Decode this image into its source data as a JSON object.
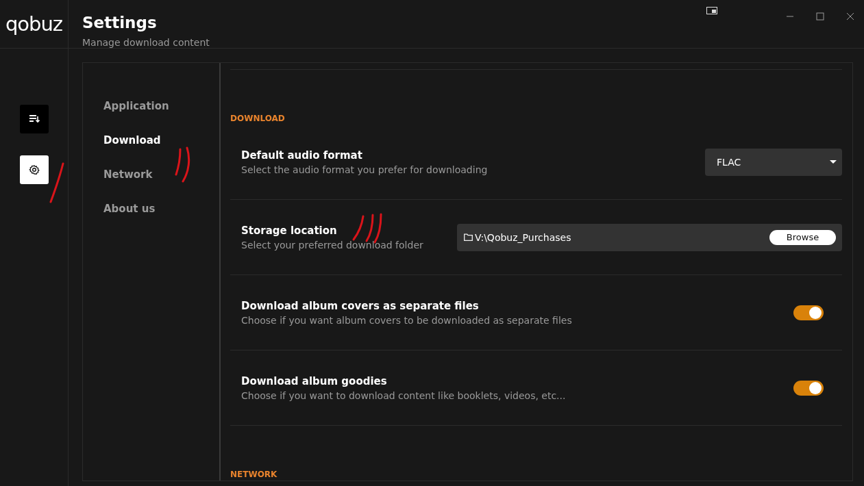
{
  "app": {
    "logo": "qobuz"
  },
  "header": {
    "title": "Settings",
    "subtitle": "Manage download content"
  },
  "rail_items": [
    {
      "kind": "download-list",
      "selected": false
    },
    {
      "kind": "gear",
      "selected": true
    }
  ],
  "nav": [
    {
      "label": "Application",
      "selected": false
    },
    {
      "label": "Download",
      "selected": true
    },
    {
      "label": "Network",
      "selected": false
    },
    {
      "label": "About us",
      "selected": false
    }
  ],
  "sections": [
    {
      "heading": "DOWNLOAD",
      "rows": [
        {
          "kind": "select",
          "title": "Default audio format",
          "description": "Select the audio format you prefer for downloading",
          "value": "FLAC"
        },
        {
          "kind": "folder",
          "title": "Storage location",
          "description": "Select your preferred download folder",
          "value": "V:\\Qobuz_Purchases",
          "button": "Browse"
        },
        {
          "kind": "toggle",
          "title": "Download album covers as separate files",
          "description": "Choose if you want album covers to be downloaded as separate files",
          "on": true
        },
        {
          "kind": "toggle",
          "title": "Download album goodies",
          "description": "Choose if you want to download content like booklets, videos, etc...",
          "on": true
        }
      ]
    },
    {
      "heading": "NETWORK"
    }
  ]
}
